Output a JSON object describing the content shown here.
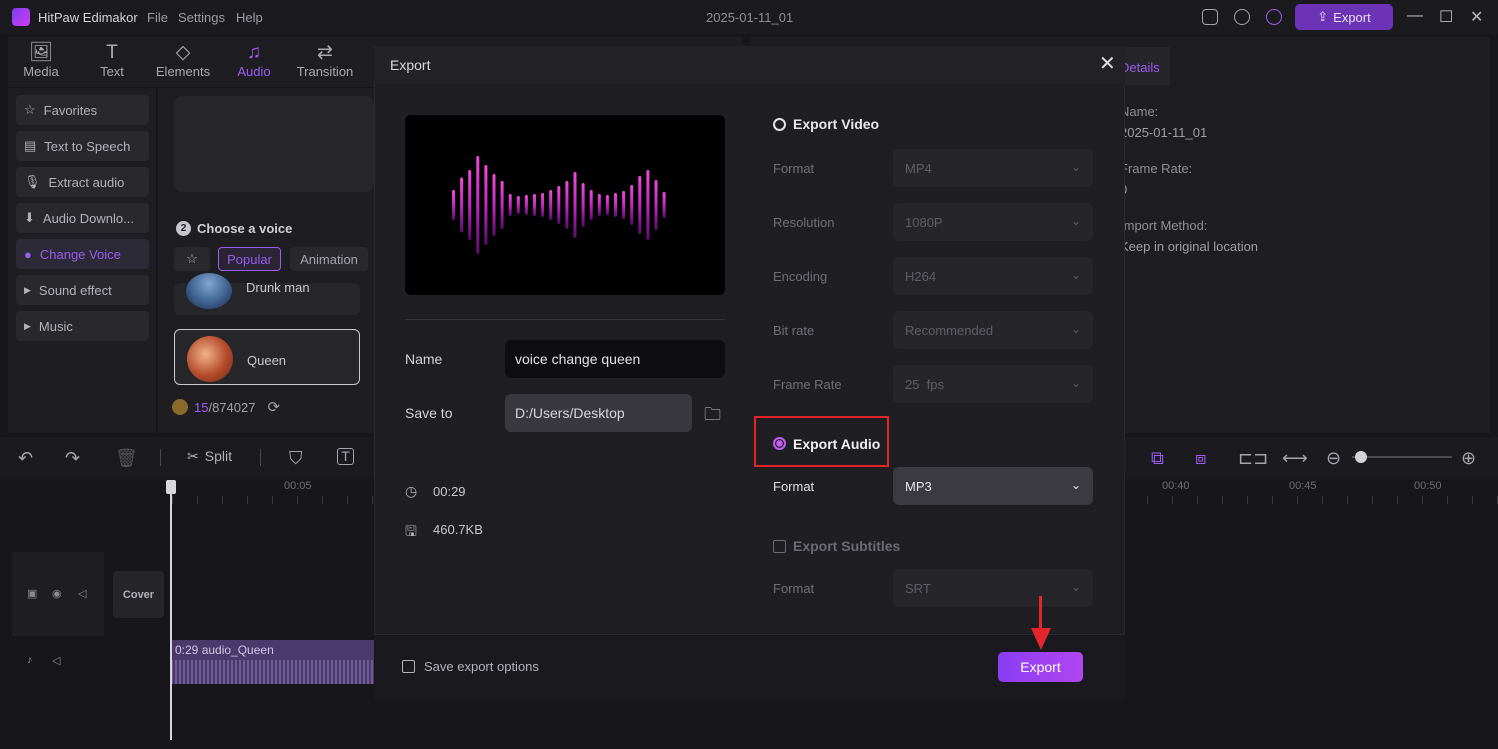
{
  "app": {
    "name": "HitPaw Edimakor",
    "menu": [
      "File",
      "Settings",
      "Help"
    ],
    "document_title": "2025-01-11_01",
    "export_button": "Export"
  },
  "tabs": [
    {
      "label": "Media",
      "icon": "media-icon",
      "glyph": "🖼"
    },
    {
      "label": "Text",
      "icon": "text-icon",
      "glyph": "T"
    },
    {
      "label": "Elements",
      "icon": "elements-icon",
      "glyph": "◇"
    },
    {
      "label": "Audio",
      "icon": "audio-icon",
      "glyph": "♫"
    },
    {
      "label": "Transition",
      "icon": "transition-icon",
      "glyph": "⇄"
    }
  ],
  "sidebar": [
    {
      "label": "Favorites",
      "glyph": "☆"
    },
    {
      "label": "Text to Speech",
      "glyph": "▤"
    },
    {
      "label": "Extract audio",
      "glyph": "🎙"
    },
    {
      "label": "Audio Downlo...",
      "glyph": "⬇"
    },
    {
      "label": "Change Voice",
      "glyph": "●"
    },
    {
      "label": "Sound effect",
      "glyph": "▶"
    },
    {
      "label": "Music",
      "glyph": "▶"
    }
  ],
  "voice_panel": {
    "step": "2",
    "title": "Choose a voice",
    "filters": [
      "Popular",
      "Animation"
    ],
    "voices": [
      "Drunk man",
      "Queen"
    ],
    "credits_used": "15",
    "credits_total": "/874027"
  },
  "details": {
    "tab": "Details",
    "name_label": "Name:",
    "name_value": "2025-01-11_01",
    "frame_rate_label": "Frame Rate:",
    "frame_rate_value": "0",
    "import_label": "Import Method:",
    "import_value": "Keep in original location"
  },
  "timeline": {
    "split_label": "Split",
    "ruler": [
      "00:05",
      "00:40",
      "00:45",
      "00:50"
    ],
    "cover_label": "Cover",
    "clip_label": "0:29 audio_Queen"
  },
  "export_dialog": {
    "title": "Export",
    "name_label": "Name",
    "name_value": "voice change queen",
    "save_label": "Save to",
    "save_value": "D:/Users/Desktop",
    "duration": "00:29",
    "size": "460.7KB",
    "video": {
      "title": "Export Video",
      "selected": false,
      "rows": [
        {
          "label": "Format",
          "value": "MP4"
        },
        {
          "label": "Resolution",
          "value": "1080P"
        },
        {
          "label": "Encoding",
          "value": "H264"
        },
        {
          "label": "Bit rate",
          "value": "Recommended"
        },
        {
          "label": "Frame Rate",
          "value": "25  fps"
        }
      ]
    },
    "audio": {
      "title": "Export Audio",
      "selected": true,
      "format_label": "Format",
      "format_value": "MP3"
    },
    "subtitles": {
      "title": "Export Subtitles",
      "checked": false,
      "format_label": "Format",
      "format_value": "SRT"
    },
    "save_options_label": "Save export options",
    "export_button": "Export"
  },
  "colors": {
    "accent": "#9b5cf0",
    "highlight": "#e0242a",
    "export_gradient": "#8a3df2"
  }
}
